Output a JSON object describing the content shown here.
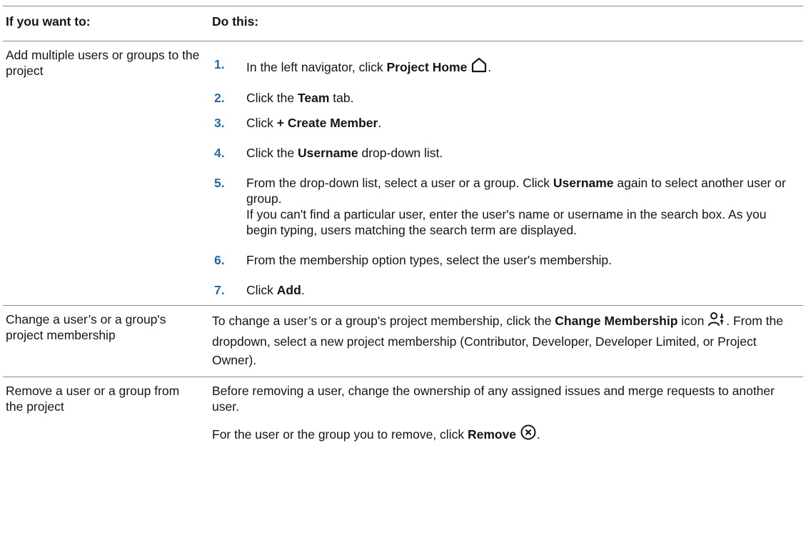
{
  "headers": {
    "col1": "If you want to:",
    "col2": "Do this:"
  },
  "row1": {
    "want": "Add multiple users or groups to the project",
    "steps": [
      {
        "num": "1.",
        "pre": "In the left navigator, click ",
        "bold": "Project Home",
        "post": "."
      },
      {
        "num": "2.",
        "pre": "Click the ",
        "bold": "Team",
        "post": " tab."
      },
      {
        "num": "3.",
        "pre": "Click ",
        "bold": "+ Create Member",
        "post": "."
      },
      {
        "num": "4.",
        "pre": "Click the ",
        "bold": "Username",
        "post": " drop-down list."
      },
      {
        "num": "5.",
        "pre": "From the drop-down list, select a user or a group. Click ",
        "bold": "Username",
        "post": " again to select another user or group.",
        "extra": "If you can't find a particular user, enter the user's name or username in the search box. As you begin typing, users matching the search term are displayed."
      },
      {
        "num": "6.",
        "pre": "From the membership option types, select the user's membership.",
        "bold": "",
        "post": ""
      },
      {
        "num": "7.",
        "pre": "Click ",
        "bold": "Add",
        "post": "."
      }
    ],
    "icon": "home-icon"
  },
  "row2": {
    "want": "Change a user’s or a group's project membership",
    "pre": "To change a user’s or a group's project membership, click the ",
    "bold": "Change Membership",
    "mid": " icon ",
    "post": ". From the dropdown, select a new project membership (Contributor, Developer, Developer Limited, or Project Owner).",
    "icon": "change-membership-icon"
  },
  "row3": {
    "want": "Remove a user or a group from the project",
    "para1": "Before removing a user, change the ownership of any assigned issues and merge requests to another user.",
    "pre": "For the user or the group you to remove, click ",
    "bold": "Remove",
    "post": ".",
    "icon": "remove-circle-icon"
  },
  "colors": {
    "step_number": "#1f6ca8",
    "rule": "#8a8a8a",
    "text": "#161513"
  }
}
